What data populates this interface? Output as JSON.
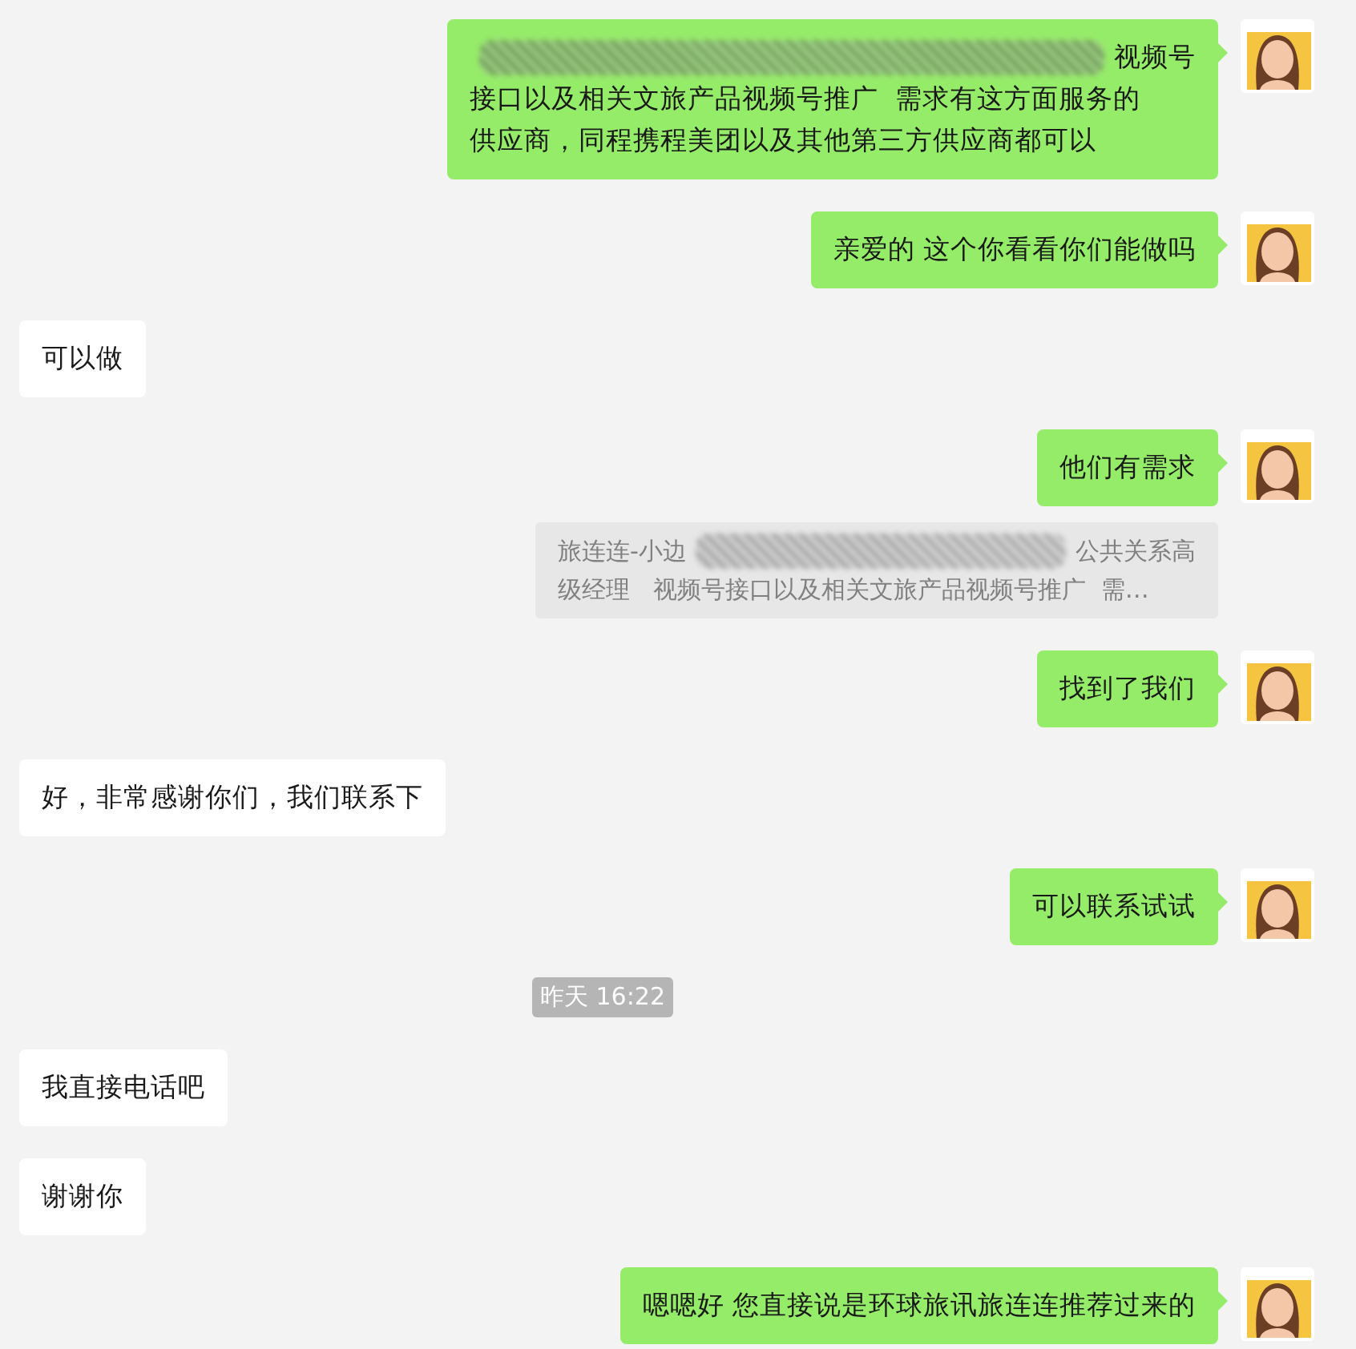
{
  "messages": [
    {
      "kind": "text",
      "outgoing": true,
      "lines": [
        [
          {
            "kind": "redaction"
          },
          {
            "kind": "text",
            "text": "视频号"
          }
        ],
        [
          {
            "kind": "text",
            "text": "接口以及相关文旅产品视频号推广  需求有这方面服务的"
          }
        ],
        [
          {
            "kind": "text",
            "text": "供应商，同程携程美团以及其他第三方供应商都可以"
          }
        ]
      ]
    },
    {
      "kind": "text",
      "outgoing": true,
      "lines": [
        [
          {
            "kind": "text",
            "text": "亲爱的 这个你看看你们能做吗"
          }
        ]
      ]
    },
    {
      "kind": "text",
      "outgoing": false,
      "lines": [
        [
          {
            "kind": "text",
            "text": "可以做"
          }
        ]
      ]
    },
    {
      "kind": "text",
      "outgoing": true,
      "lines": [
        [
          {
            "kind": "text",
            "text": "他们有需求"
          }
        ]
      ]
    },
    {
      "kind": "quote",
      "outgoing": true,
      "lines": [
        [
          {
            "kind": "text",
            "text": "旅连连-小边"
          },
          {
            "kind": "redaction"
          },
          {
            "kind": "text",
            "text": "公共关系高"
          }
        ],
        [
          {
            "kind": "text",
            "text": "级经理   视频号接口以及相关文旅产品视频号推广  需…"
          }
        ]
      ]
    },
    {
      "kind": "text",
      "outgoing": true,
      "lines": [
        [
          {
            "kind": "text",
            "text": "找到了我们"
          }
        ]
      ]
    },
    {
      "kind": "text",
      "outgoing": false,
      "lines": [
        [
          {
            "kind": "text",
            "text": "好，非常感谢你们，我们联系下"
          }
        ]
      ]
    },
    {
      "kind": "text",
      "outgoing": true,
      "lines": [
        [
          {
            "kind": "text",
            "text": "可以联系试试"
          }
        ]
      ]
    },
    {
      "kind": "time",
      "text": "昨天 16:22"
    },
    {
      "kind": "text",
      "outgoing": false,
      "lines": [
        [
          {
            "kind": "text",
            "text": "我直接电话吧"
          }
        ]
      ]
    },
    {
      "kind": "text",
      "outgoing": false,
      "lines": [
        [
          {
            "kind": "text",
            "text": "谢谢你"
          }
        ]
      ]
    },
    {
      "kind": "text",
      "outgoing": true,
      "lines": [
        [
          {
            "kind": "text",
            "text": "嗯嗯好 您直接说是环球旅讯旅连连推荐过来的"
          }
        ]
      ]
    }
  ]
}
